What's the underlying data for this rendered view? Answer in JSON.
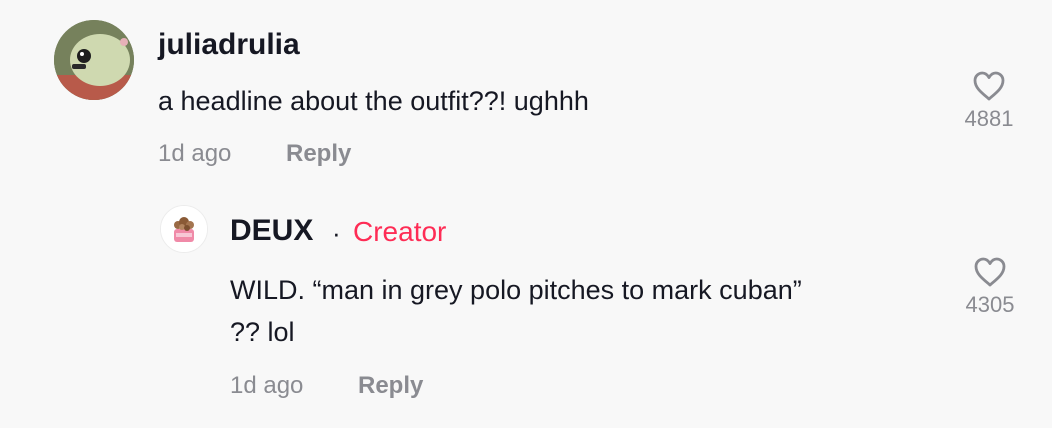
{
  "comments": [
    {
      "username": "juliadrulia",
      "text": "a headline about the outfit??! ughhh",
      "time": "1d ago",
      "reply_label": "Reply",
      "likes": "4881"
    }
  ],
  "reply": {
    "username": "DEUX",
    "separator": "·",
    "badge": "Creator",
    "text_line1": "WILD. “man in grey polo pitches to mark cuban”",
    "text_line2": "?? lol",
    "time": "1d ago",
    "reply_label": "Reply",
    "likes": "4305"
  },
  "icons": {
    "like": "heart-outline-icon"
  },
  "colors": {
    "creator_badge": "#fe2c55",
    "secondary_text": "#8a8b91",
    "primary_text": "#161823"
  }
}
